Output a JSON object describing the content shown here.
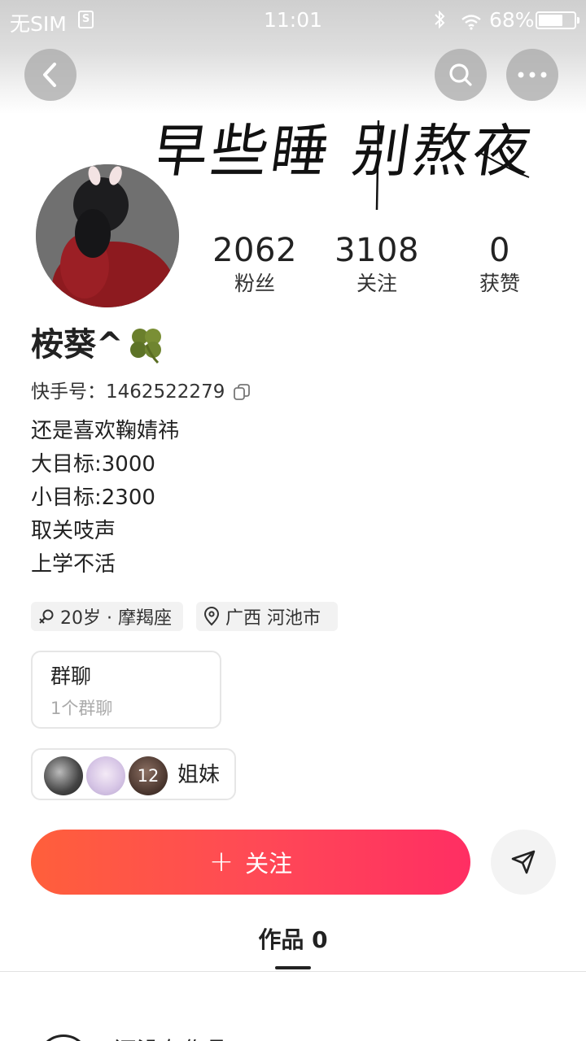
{
  "status_bar": {
    "carrier": "无SIM",
    "sim_icon": "sim-icon",
    "time": "11:01",
    "battery": "68%",
    "battery_level": 0.68
  },
  "header": {
    "back_icon": "back-icon",
    "search_icon": "search-icon",
    "more_icon": "more-icon",
    "banner_text": "早些睡 别熬夜"
  },
  "profile": {
    "stats": [
      {
        "value": "2062",
        "label": "粉丝"
      },
      {
        "value": "3108",
        "label": "关注"
      },
      {
        "value": "0",
        "label": "获赞"
      }
    ],
    "nickname": "桉葵^",
    "kuaishou_id": "快手号：1462522279",
    "bio": [
      "还是喜欢鞠婧祎",
      "大目标:3000",
      "小目标:2300",
      "取关吱声",
      "上学不活"
    ],
    "tags": {
      "age": "20岁 · 摩羯座",
      "location": "广西 河池市"
    }
  },
  "group_chat": {
    "title": "群聊",
    "subtitle": "1个群聊"
  },
  "sisters": {
    "count": "12",
    "label": "姐妹"
  },
  "actions": {
    "follow_label": "关注",
    "follow_gradient": [
      "#ff5f3b",
      "#ff2e63"
    ]
  },
  "tabs": {
    "works_label": "作品 0"
  },
  "empty_state": {
    "text": "还没有作品"
  }
}
